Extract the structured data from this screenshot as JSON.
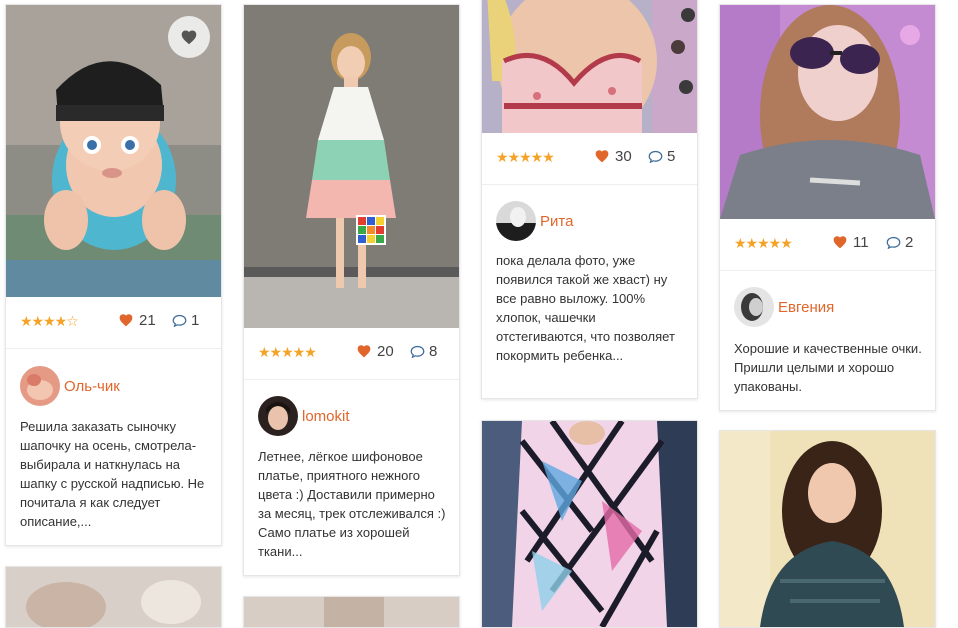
{
  "colors": {
    "accent": "#e0662c",
    "heart": "#e0662c",
    "star": "#f4a327"
  },
  "cards": [
    {
      "photo": "baby in black knit hat",
      "stars_icon": "star-rating-4",
      "stars": "★★★★☆",
      "likes": "21",
      "comments": "1",
      "author": "Оль-чик",
      "text": "Решила заказать сыночку шапочку на осень, смотрела-выбирала и наткнулась на шапку с русской надписью. Не почитала я как следует описание,..."
    },
    {
      "photo": "woman in pastel color-block dress",
      "stars": "★★★★★",
      "likes": "20",
      "comments": "8",
      "author": "lomokit",
      "text": "Летнее, лёгкое шифоновое платье, приятного нежного цвета :) Доставили примерно за месяц, трек отслеживался :) Само платье из хорошей ткани..."
    },
    {
      "photo": "floral lace bra",
      "stars": "★★★★★",
      "likes": "30",
      "comments": "5",
      "author": "Рита",
      "text": "пока делала фото, уже появился такой же хваст) ну все равно выложу. 100% хлопок, чашечки отстегиваются, что позволяет покормить ребенка..."
    },
    {
      "photo": "woman wearing sunglasses",
      "stars": "★★★★★",
      "likes": "11",
      "comments": "2",
      "author": "Евгения",
      "text": "Хорошие и качественные очки. Пришли целыми и хорошо упакованы."
    }
  ]
}
